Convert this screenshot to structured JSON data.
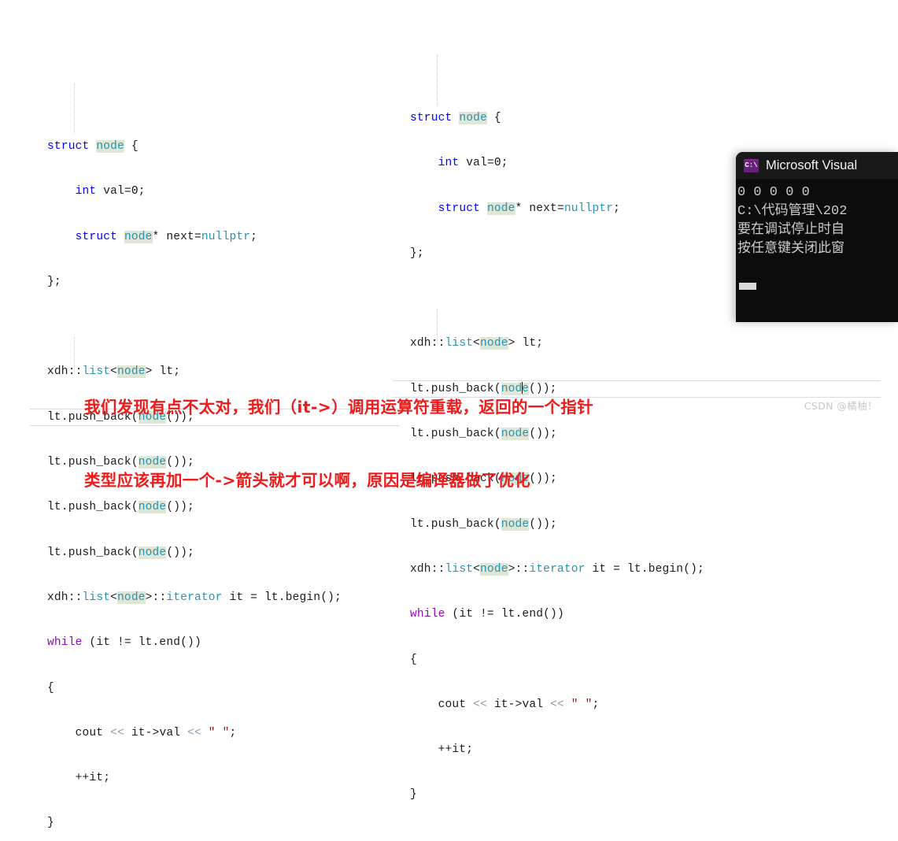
{
  "left_editor": {
    "name": "left-code-pane",
    "lines": [
      "struct node {",
      "    int val=0;",
      "    struct node* next=nullptr;",
      "};",
      "",
      "xdh::list<node> lt;",
      "lt.push_back(node());",
      "lt.push_back(node());",
      "lt.push_back(node());",
      "lt.push_back(node());",
      "xdh::list<node>::iterator it = lt.begin();",
      "while (it != lt.end())",
      "{",
      "    cout << it->val << \" \";",
      "    ++it;",
      "}"
    ],
    "current_line_index": 6
  },
  "right_editor": {
    "name": "right-code-pane",
    "lines": [
      "struct node {",
      "    int val=0;",
      "    struct node* next=nullptr;",
      "};",
      "",
      "xdh::list<node> lt;",
      "lt.push_back(node());",
      "lt.push_back(node());",
      "lt.push_back(node());",
      "lt.push_back(node());",
      "xdh::list<node>::iterator it = lt.begin();",
      "while (it != lt.end())",
      "{",
      "    cout << it->val << \" \";",
      "    ++it;",
      "}"
    ],
    "current_line_index": 6,
    "caret_line_index": 6
  },
  "console": {
    "title": "Microsoft Visual",
    "icon_label": "C:\\",
    "output_lines": [
      "0 0 0 0 0",
      "C:\\代码管理\\202",
      "要在调试停止时自",
      "按任意键关闭此窗"
    ]
  },
  "annotation": {
    "line1": "我们发现有点不太对，我们（it->）调用运算符重载，返回的一个指针",
    "line2": "类型应该再加一个->箭头就才可以啊，原因是编译器做了优化",
    "color": "#f01a1a"
  },
  "watermark": {
    "text": "CSDN @橘柚！"
  },
  "theme": {
    "background": "#ffffff",
    "keyword": "#0000ff",
    "control_keyword": "#8f08c4",
    "type": "#2b91af",
    "string": "#a31515",
    "operator": "#8a9ba8",
    "reference_highlight": "#dfe6d5",
    "current_line_border": "#d9dce6",
    "console_bg": "#0c0c0c",
    "console_icon": "#68217a"
  }
}
